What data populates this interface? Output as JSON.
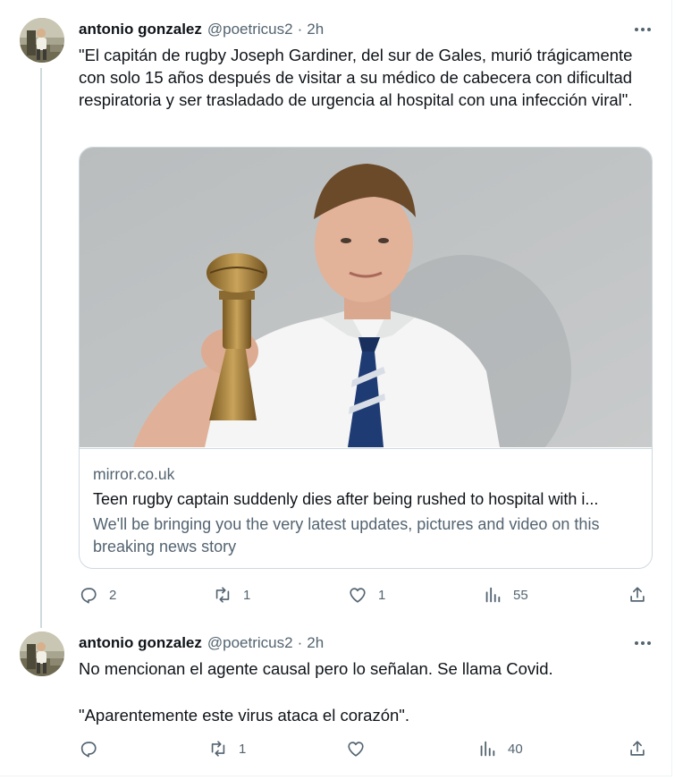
{
  "tweets": [
    {
      "author": {
        "name": "antonio gonzalez",
        "handle": "@poetricus2",
        "separator": "·",
        "time": "2h"
      },
      "text": "\"El capitán de rugby Joseph Gardiner, del sur de Gales, murió trágicamente con solo 15 años después de visitar a su médico de cabecera con dificultad respiratoria y ser trasladado de urgencia al hospital con una infección viral\".",
      "card": {
        "domain": "mirror.co.uk",
        "title": "Teen rugby captain suddenly dies after being rushed to hospital with i...",
        "description": "We'll be bringing you the very latest updates, pictures and video on this breaking news story"
      },
      "stats": {
        "replies": "2",
        "retweets": "1",
        "likes": "1",
        "views": "55"
      }
    },
    {
      "author": {
        "name": "antonio gonzalez",
        "handle": "@poetricus2",
        "separator": "·",
        "time": "2h"
      },
      "paragraphs": [
        "No mencionan el agente causal pero lo señalan. Se llama Covid.",
        "\"Aparentemente este virus ataca el corazón\"."
      ],
      "stats": {
        "replies": "",
        "retweets": "1",
        "likes": "",
        "views": "40"
      }
    }
  ],
  "icons": {
    "reply": "reply-icon",
    "retweet": "retweet-icon",
    "like": "heart-icon",
    "views": "views-chart-icon",
    "share": "share-icon",
    "more": "more-dots-icon"
  },
  "colors": {
    "text": "#0f1419",
    "secondary": "#536471",
    "border": "#cfd9de",
    "thread_line": "#cfd9de"
  }
}
